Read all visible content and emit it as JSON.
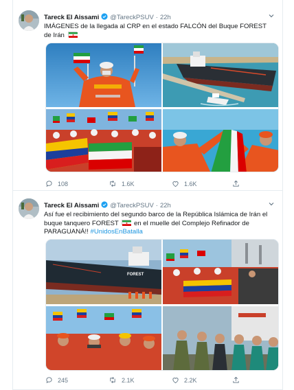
{
  "tweets": [
    {
      "name": "Tareck El Aissami",
      "handle": "@TareckPSUV",
      "dot": "·",
      "time": "22h",
      "text_before": "IMÁGENES de la llegada al CRP en el estado FALCÓN del Buque FOREST de Irán",
      "hashtag": "",
      "replies": "108",
      "retweets": "1.6K",
      "likes": "1.6K"
    },
    {
      "name": "Tareck El Aissami",
      "handle": "@TareckPSUV",
      "dot": "·",
      "time": "22h",
      "text_before": "Así fue el recibimiento del segundo barco de la República Islámica de Irán el buque tanquero FOREST",
      "text_after": "en el muelle del Complejo Refinador de PARAGUANÁ!!",
      "hashtag": "#UnidosEnBatalla",
      "replies": "245",
      "retweets": "2.1K",
      "likes": "2.2K"
    }
  ],
  "ship_name": "FOREST",
  "icons": [
    "verified-badge-icon",
    "chevron-down-icon",
    "reply-icon",
    "retweet-icon",
    "like-icon",
    "share-icon",
    "iran-flag-icon"
  ],
  "colors": {
    "accent": "#1da1f2",
    "link": "#1b95e0",
    "muted": "#657786",
    "border": "#e6ecf0",
    "worker_orange": "#e8551f"
  }
}
